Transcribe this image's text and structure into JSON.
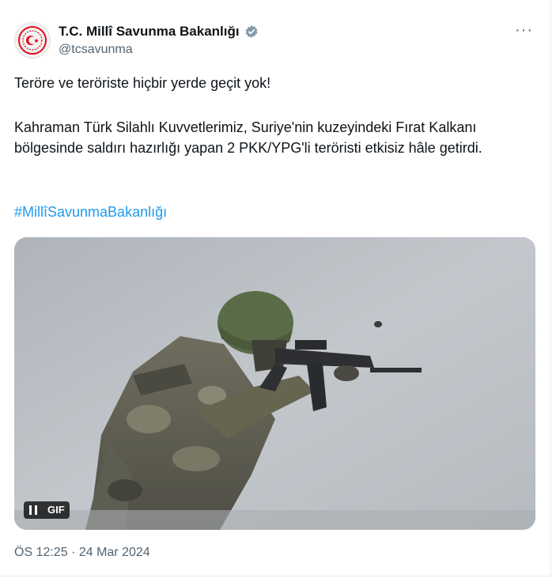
{
  "account": {
    "display_name": "T.C. Millî Savunma Bakanlığı",
    "handle": "@tcsavunma",
    "verified_color": "#829aab"
  },
  "more_label": "···",
  "tweet": {
    "line1": "Teröre ve teröriste hiçbir yerde geçit yok!",
    "line2": "Kahraman Türk Silahlı Kuvvetlerimiz, Suriye'nin kuzeyindeki Fırat Kalkanı bölgesinde saldırı hazırlığı yapan 2 PKK/YPG'li teröristi etkisiz hâle getirdi.",
    "hashtag": "#MillîSavunmaBakanlığı"
  },
  "media": {
    "badge": "GIF"
  },
  "timestamp": "ÖS 12:25 · 24 Mar 2024",
  "colors": {
    "link": "#1d9bf0",
    "secondary_text": "#536471",
    "emblem_red": "#e30a17"
  }
}
